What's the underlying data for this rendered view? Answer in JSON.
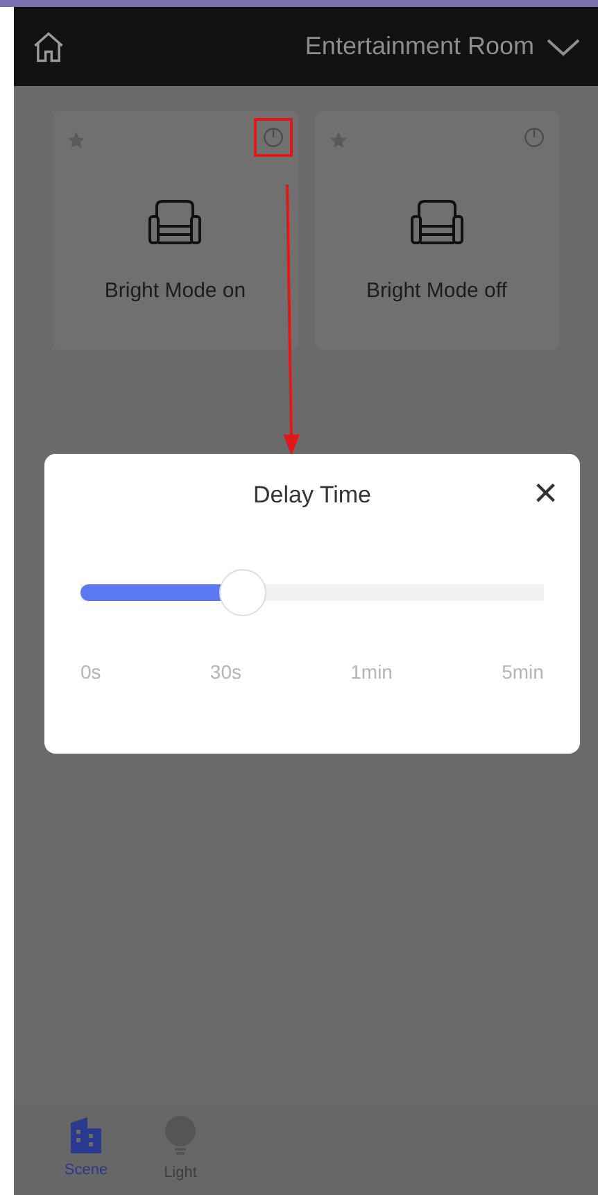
{
  "header": {
    "title": "Entertainment Room"
  },
  "scenes": [
    {
      "name": "Bright Mode on",
      "highlighted": true
    },
    {
      "name": "Bright Mode off",
      "highlighted": false
    }
  ],
  "dialog": {
    "title": "Delay Time",
    "close": "×",
    "slider": {
      "level": 0.35
    },
    "ticks": [
      "0s",
      "30s",
      "1min",
      "5min"
    ]
  },
  "tabs": [
    {
      "label": "Scene",
      "kind": "scene",
      "selected": true
    },
    {
      "label": "Light",
      "kind": "light",
      "selected": false
    }
  ]
}
